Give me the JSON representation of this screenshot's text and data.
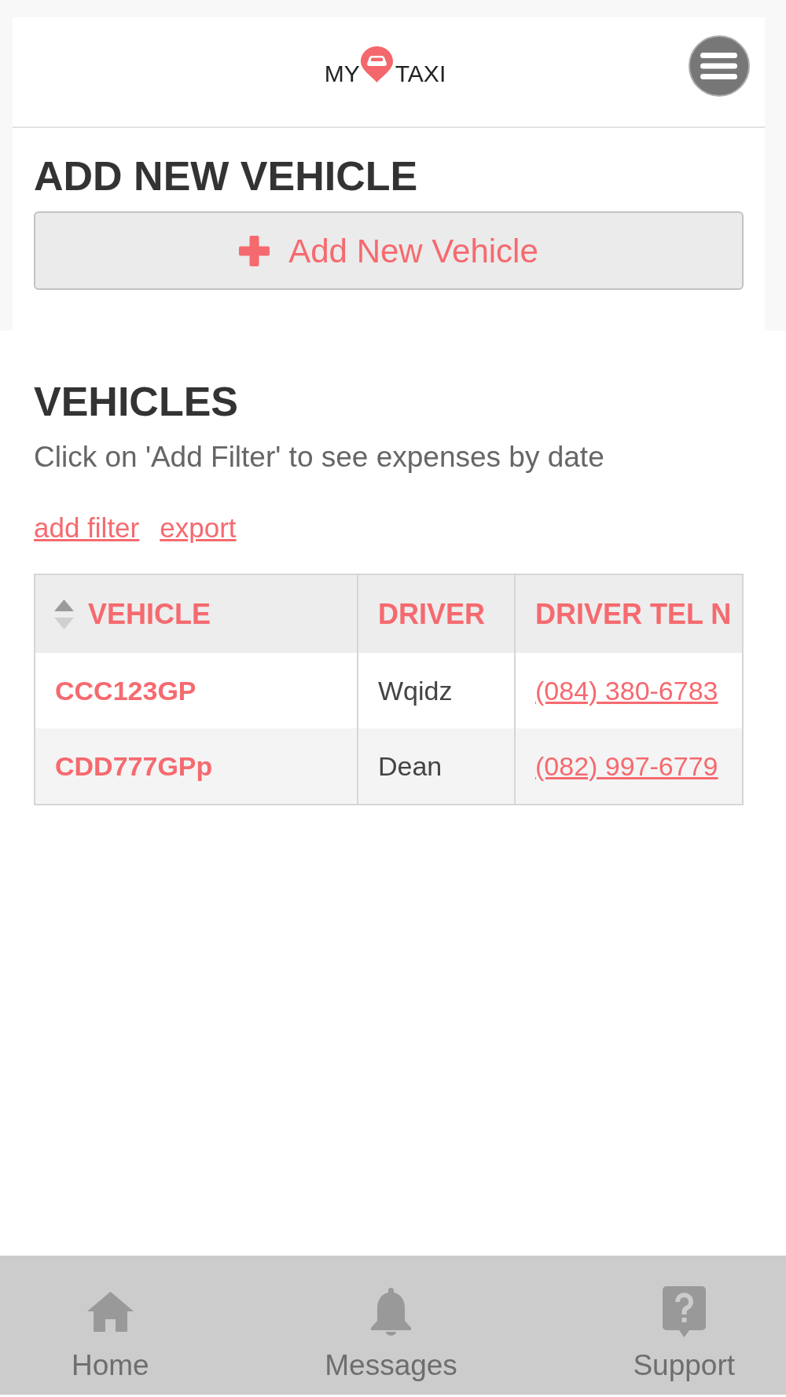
{
  "header": {
    "logo": {
      "text_before_pin": "MY",
      "text_after_pin": "TAXI"
    }
  },
  "add_vehicle": {
    "title": "ADD NEW VEHICLE",
    "button": "Add New Vehicle"
  },
  "vehicles": {
    "title": "VEHICLES",
    "subtitle": "Click on 'Add Filter' to see expenses by date",
    "links": [
      "add filter",
      "export"
    ],
    "table": {
      "columns": [
        {
          "label": "VEHICLE",
          "sort_ascending": true
        },
        {
          "label": "DRIVER"
        },
        {
          "label": "DRIVER TEL N"
        }
      ],
      "rows": [
        {
          "vehicle": "CCC123GP",
          "driver": "Wqidz",
          "driver_tel": "(084) 380-6783"
        },
        {
          "vehicle": "CDD777GPp",
          "driver": "Dean",
          "driver_tel": "(082) 997-6779"
        }
      ]
    }
  },
  "bottom_nav": [
    {
      "label": "Home"
    },
    {
      "label": "Messages"
    },
    {
      "label": "Support"
    }
  ]
}
